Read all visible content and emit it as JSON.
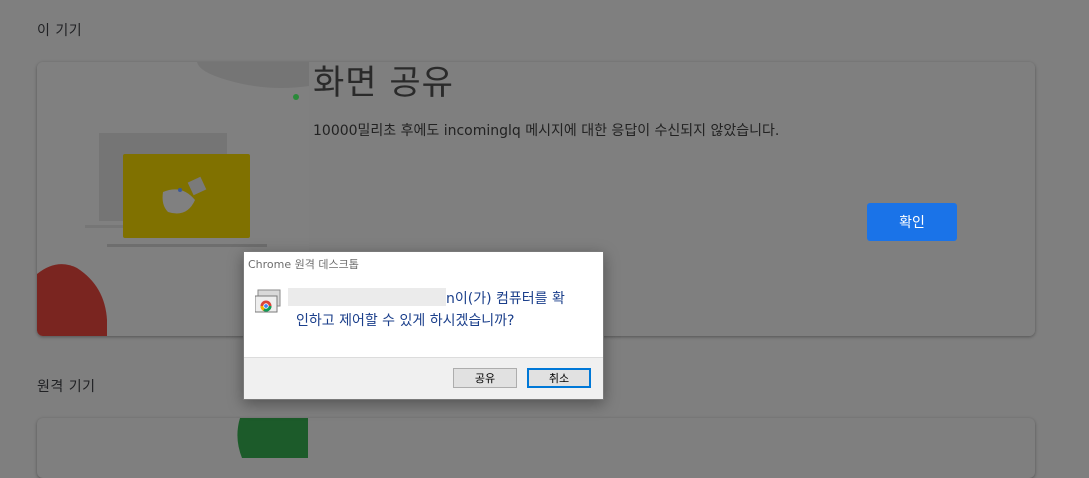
{
  "sections": {
    "this_device": "이 기기",
    "remote_devices": "원격 기기"
  },
  "dialog": {
    "title": "화면 공유",
    "message": "10000밀리초 후에도 incominglq 메시지에 대한 응답이 수신되지 않았습니다.",
    "ok_label": "확인",
    "accent_color": "#1a73e8"
  },
  "prompt": {
    "title": "Chrome 원격 데스크톱",
    "message_line1_suffix": "n이(가) 컴퓨터를 확",
    "message_line2": "인하고 제어할 수 있게 하시겠습니까?",
    "share_label": "공유",
    "cancel_label": "취소",
    "icon": "chrome-remote-desktop-icon"
  }
}
